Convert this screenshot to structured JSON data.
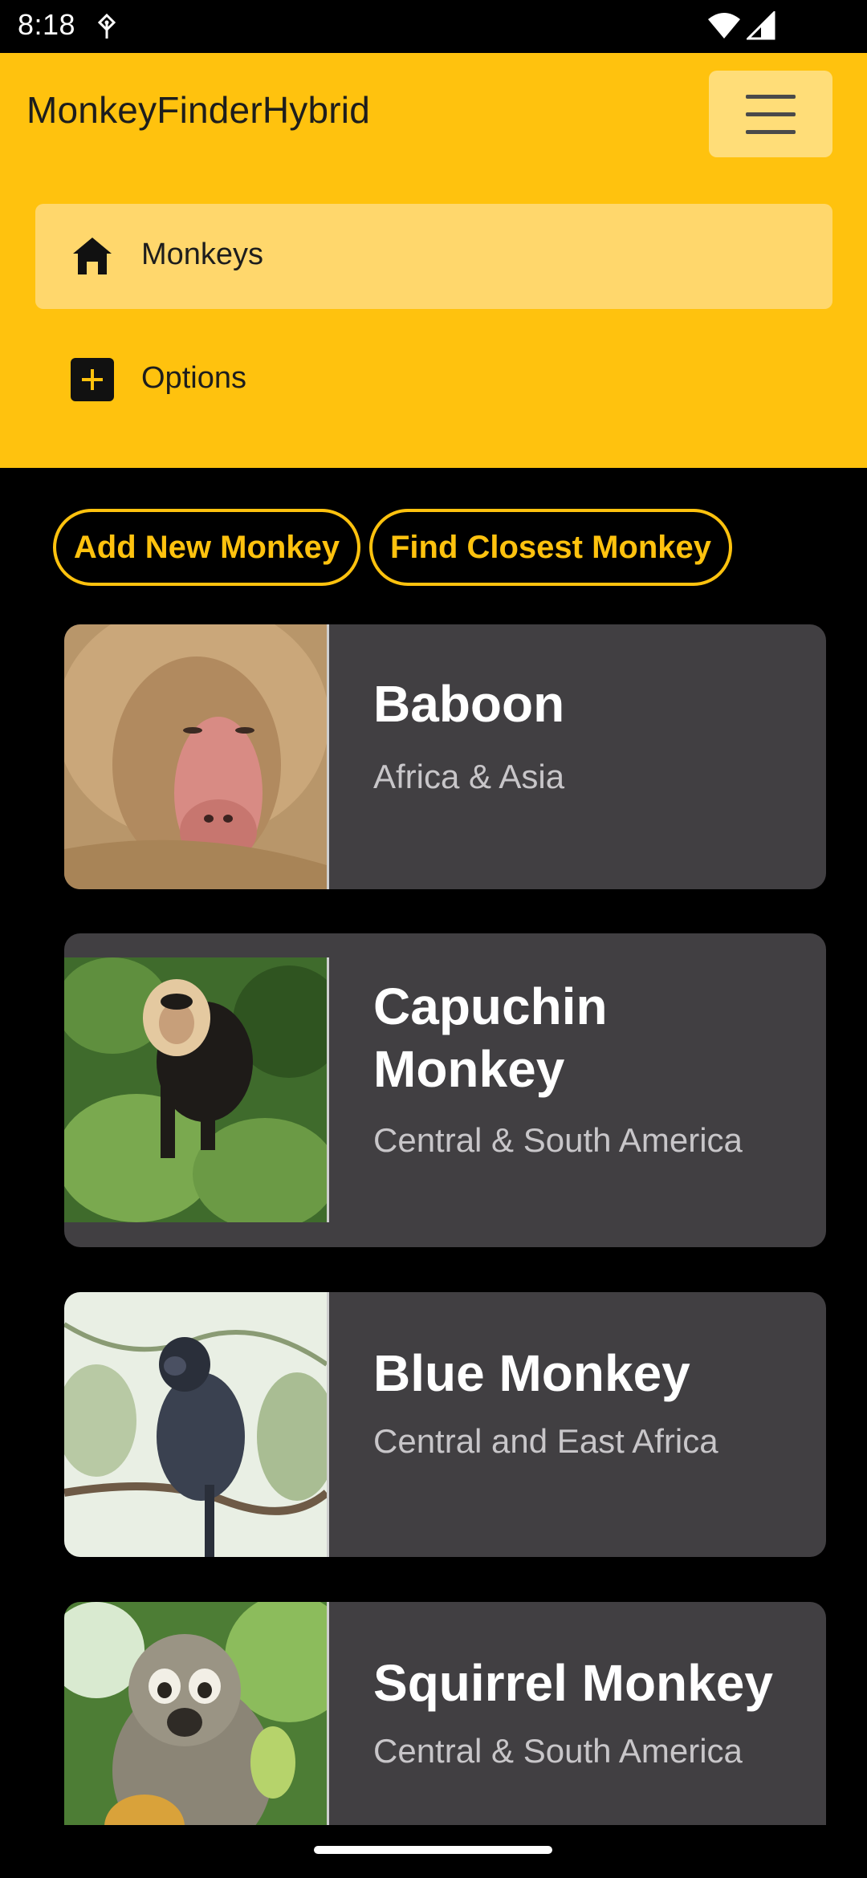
{
  "status_bar": {
    "time": "8:18",
    "icons": [
      "usb-debug-icon",
      "wifi-icon",
      "cell-signal-icon"
    ]
  },
  "header": {
    "title": "MonkeyFinderHybrid",
    "menu_icon": "hamburger-menu-icon",
    "background_color": "#FFC20E"
  },
  "nav": {
    "items": [
      {
        "label": "Monkeys",
        "icon": "home-icon",
        "active": true
      },
      {
        "label": "Options",
        "icon": "plus-square-icon",
        "active": false
      }
    ]
  },
  "actions": {
    "add_label": "Add New Monkey",
    "find_label": "Find Closest Monkey",
    "accent_color": "#FFC20E"
  },
  "monkeys": [
    {
      "name": "Baboon",
      "location": "Africa & Asia"
    },
    {
      "name": "Capuchin Monkey",
      "location": "Central & South America"
    },
    {
      "name": "Blue Monkey",
      "location": "Central and East Africa"
    },
    {
      "name": "Squirrel Monkey",
      "location": "Central & South America"
    }
  ],
  "colors": {
    "card_background": "#413F42",
    "page_background": "#000000"
  }
}
